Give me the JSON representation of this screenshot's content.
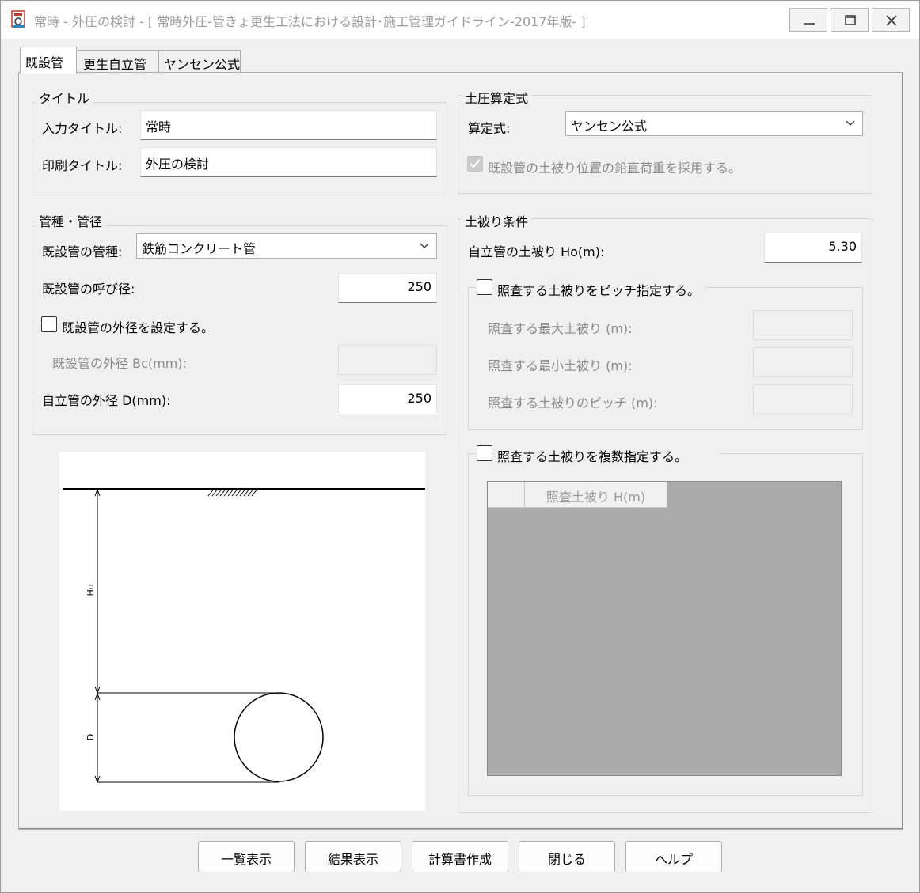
{
  "window": {
    "title": "常時 - 外圧の検討 - [ 常時外圧-管きょ更生工法における設計･施工管理ガイドライン-2017年版- ]"
  },
  "tabs": [
    {
      "label": "既設管"
    },
    {
      "label": "更生自立管"
    },
    {
      "label": "ヤンセン公式"
    }
  ],
  "title_group": {
    "heading": "タイトル",
    "input_title_label": "入力タイトル:",
    "input_title_value": "常時",
    "print_title_label": "印刷タイトル:",
    "print_title_value": "外圧の検討"
  },
  "pipe_group": {
    "heading": "管種・管径",
    "type_label": "既設管の管種:",
    "type_value": "鉄筋コンクリート管",
    "nominal_label": "既設管の呼び径:",
    "nominal_value": "250",
    "set_outer_label": "既設管の外径を設定する。",
    "set_outer_checked": false,
    "outer_bc_label": "既設管の外径 Bc(mm):",
    "outer_bc_value": "",
    "outer_d_label": "自立管の外径 D(mm):",
    "outer_d_value": "250"
  },
  "diagram": {
    "ho_label": "Ho",
    "d_label": "D"
  },
  "earth_pressure_group": {
    "heading": "土圧算定式",
    "formula_label": "算定式:",
    "formula_value": "ヤンセン公式",
    "adopt_label": "既設管の土被り位置の鉛直荷重を採用する。",
    "adopt_checked": true
  },
  "cover_group": {
    "heading": "土被り条件",
    "ho_label": "自立管の土被り Ho(m):",
    "ho_value": "5.30",
    "pitch_label": "照査する土被りをピッチ指定する。",
    "pitch_checked": false,
    "max_label": "照査する最大土被り (m):",
    "min_label": "照査する最小土被り (m):",
    "step_label": "照査する土被りのピッチ (m):",
    "multi_label": "照査する土被りを複数指定する。",
    "multi_checked": false,
    "grid_header": "照査土被り H(m)"
  },
  "buttons": [
    {
      "label": "一覧表示"
    },
    {
      "label": "結果表示"
    },
    {
      "label": "計算書作成"
    },
    {
      "label": "閉じる"
    },
    {
      "label": "ヘルプ"
    }
  ],
  "colors": {
    "window_bg": "#f0f0f0",
    "grid_bg": "#ababab",
    "disabled_text": "#8a8a8a"
  }
}
